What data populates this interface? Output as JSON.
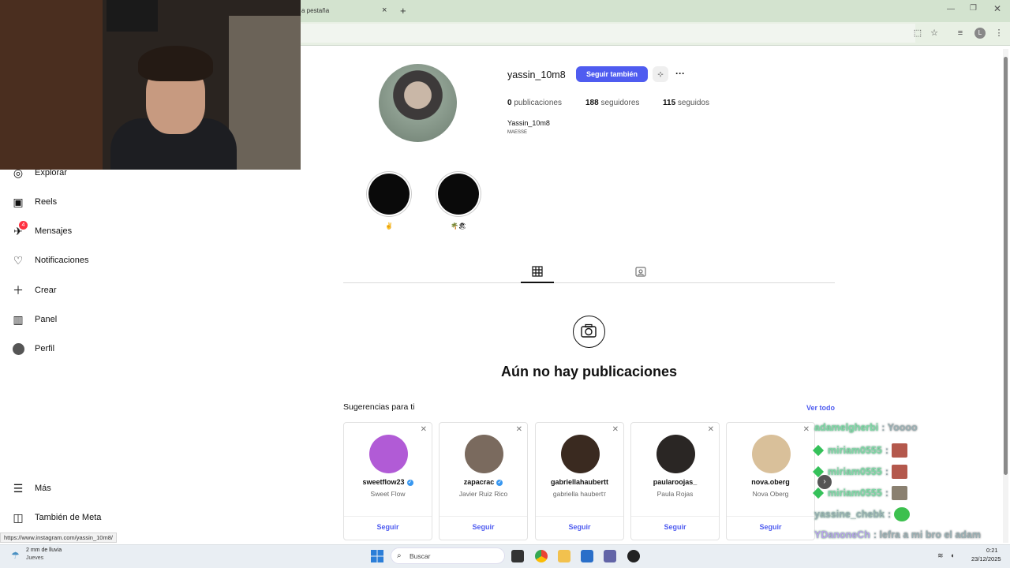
{
  "browser": {
    "tab_label": "a pestaña",
    "tab_close": "×",
    "new_tab": "+",
    "profile_initial": "L",
    "status_url": "https://www.instagram.com/yassin_10m8/"
  },
  "sidebar": {
    "items": [
      {
        "label": "Explorar",
        "icon": "compass-icon"
      },
      {
        "label": "Reels",
        "icon": "reels-icon"
      },
      {
        "label": "Mensajes",
        "icon": "messenger-icon",
        "badge": "4"
      },
      {
        "label": "Notificaciones",
        "icon": "heart-icon"
      },
      {
        "label": "Crear",
        "icon": "plus-icon"
      },
      {
        "label": "Panel",
        "icon": "dashboard-icon"
      },
      {
        "label": "Perfil",
        "icon": "avatar-icon"
      }
    ],
    "more_label": "Más",
    "meta_label": "También de Meta"
  },
  "profile": {
    "username": "yassin_10m8",
    "follow_back_label": "Seguir también",
    "more_label": "···",
    "posts_count": "0",
    "posts_label": "publicaciones",
    "followers_count": "188",
    "followers_label": "seguidores",
    "following_count": "115",
    "following_label": "seguidos",
    "display_name": "Yassin_10m8",
    "bio": "MAESSE",
    "highlights": [
      {
        "label": "✌"
      },
      {
        "label": "🌴🏖"
      }
    ],
    "empty_title": "Aún no hay publicaciones"
  },
  "suggestions": {
    "title": "Sugerencias para ti",
    "see_all": "Ver todo",
    "cards": [
      {
        "username": "sweetflow23",
        "name": "Sweet Flow",
        "verified": true,
        "follow": "Seguir",
        "avatar_color": "#b15bd6"
      },
      {
        "username": "zapacrac",
        "name": "Javier Ruiz Rico",
        "verified": true,
        "follow": "Seguir",
        "avatar_color": "#7a6a5e"
      },
      {
        "username": "gabriellahaubertt",
        "name": "gabriella haubertт",
        "verified": false,
        "follow": "Seguir",
        "avatar_color": "#3a2a20"
      },
      {
        "username": "paularoojas_",
        "name": "Paula Rojas",
        "verified": false,
        "follow": "Seguir",
        "avatar_color": "#2a2624"
      },
      {
        "username": "nova.oberg",
        "name": "Nova Oberg",
        "verified": false,
        "follow": "Seguir",
        "avatar_color": "#d9c09a"
      }
    ]
  },
  "chat": [
    {
      "user": "adamelgherbi",
      "message": ": Yoooo"
    },
    {
      "user": "miriam0555",
      "message": ":"
    },
    {
      "user": "miriam0555",
      "message": ":"
    },
    {
      "user": "miriam0555",
      "message": ":"
    },
    {
      "user": "yassine_chebk",
      "message": ":"
    },
    {
      "user": "YDanoneCh",
      "message": ": lefra a mi bro el adam"
    },
    {
      "user": "yassine_chebk",
      "message": ":"
    }
  ],
  "taskbar": {
    "weather_line1": "2 mm de lluvia",
    "weather_line2": "Jueves",
    "search_placeholder": "Buscar",
    "time": "0:21",
    "date": "23/12/2025"
  }
}
